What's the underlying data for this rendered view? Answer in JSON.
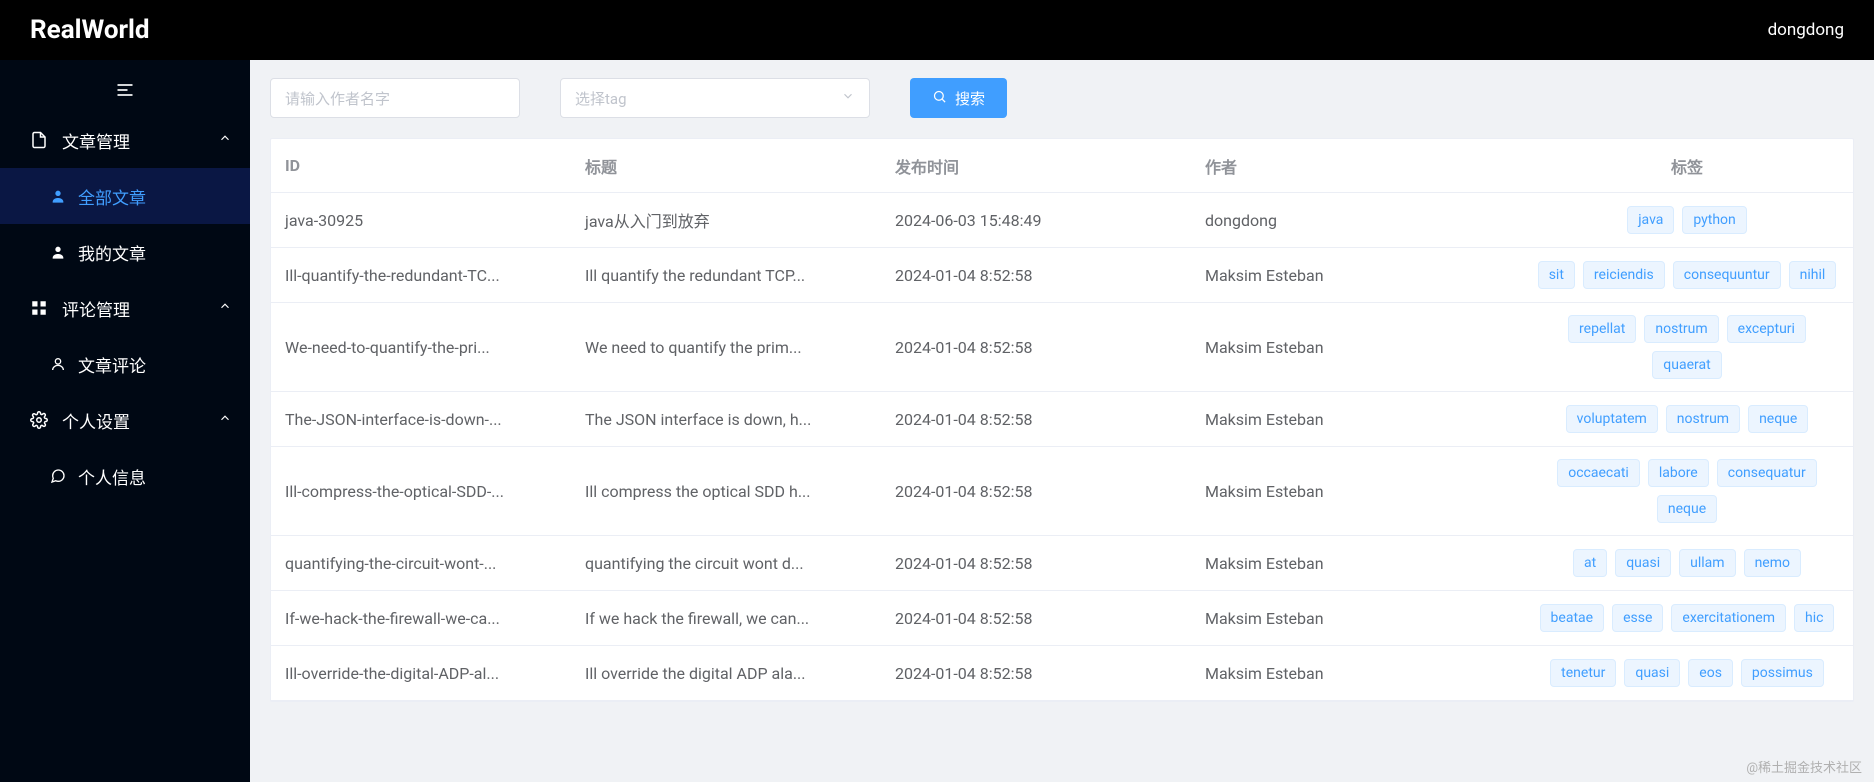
{
  "header": {
    "logo": "RealWorld",
    "user": "dongdong"
  },
  "sidebar": {
    "menu": [
      {
        "key": "article-mgmt",
        "label": "文章管理",
        "icon": "doc",
        "children": [
          {
            "key": "all-articles",
            "label": "全部文章",
            "icon": "user",
            "active": true
          },
          {
            "key": "my-articles",
            "label": "我的文章",
            "icon": "user",
            "active": false
          }
        ]
      },
      {
        "key": "comment-mgmt",
        "label": "评论管理",
        "icon": "grid",
        "children": [
          {
            "key": "article-comments",
            "label": "文章评论",
            "icon": "person",
            "active": false
          }
        ]
      },
      {
        "key": "personal-settings",
        "label": "个人设置",
        "icon": "gear",
        "children": [
          {
            "key": "personal-info",
            "label": "个人信息",
            "icon": "chat",
            "active": false
          }
        ]
      }
    ]
  },
  "filters": {
    "author_placeholder": "请输入作者名字",
    "tag_placeholder": "选择tag",
    "search_label": "搜索"
  },
  "table": {
    "columns": {
      "id": "ID",
      "title": "标题",
      "time": "发布时间",
      "author": "作者",
      "tags": "标签"
    },
    "rows": [
      {
        "id": "java-30925",
        "title": "java从入门到放弃",
        "time": "2024-06-03 15:48:49",
        "author": "dongdong",
        "tags": [
          "java",
          "python"
        ]
      },
      {
        "id": "Ill-quantify-the-redundant-TC...",
        "title": "Ill quantify the redundant TCP...",
        "time": "2024-01-04 8:52:58",
        "author": "Maksim Esteban",
        "tags": [
          "sit",
          "reiciendis",
          "consequuntur",
          "nihil"
        ]
      },
      {
        "id": "We-need-to-quantify-the-pri...",
        "title": "We need to quantify the prim...",
        "time": "2024-01-04 8:52:58",
        "author": "Maksim Esteban",
        "tags": [
          "repellat",
          "nostrum",
          "excepturi",
          "quaerat"
        ]
      },
      {
        "id": "The-JSON-interface-is-down-...",
        "title": "The JSON interface is down, h...",
        "time": "2024-01-04 8:52:58",
        "author": "Maksim Esteban",
        "tags": [
          "voluptatem",
          "nostrum",
          "neque"
        ]
      },
      {
        "id": "Ill-compress-the-optical-SDD-...",
        "title": "Ill compress the optical SDD h...",
        "time": "2024-01-04 8:52:58",
        "author": "Maksim Esteban",
        "tags": [
          "occaecati",
          "labore",
          "consequatur",
          "neque"
        ]
      },
      {
        "id": "quantifying-the-circuit-wont-...",
        "title": "quantifying the circuit wont d...",
        "time": "2024-01-04 8:52:58",
        "author": "Maksim Esteban",
        "tags": [
          "at",
          "quasi",
          "ullam",
          "nemo"
        ]
      },
      {
        "id": "If-we-hack-the-firewall-we-ca...",
        "title": "If we hack the firewall, we can...",
        "time": "2024-01-04 8:52:58",
        "author": "Maksim Esteban",
        "tags": [
          "beatae",
          "esse",
          "exercitationem",
          "hic"
        ]
      },
      {
        "id": "Ill-override-the-digital-ADP-al...",
        "title": "Ill override the digital ADP ala...",
        "time": "2024-01-04 8:52:58",
        "author": "Maksim Esteban",
        "tags": [
          "tenetur",
          "quasi",
          "eos",
          "possimus"
        ]
      }
    ]
  },
  "watermark": "@稀土掘金技术社区"
}
